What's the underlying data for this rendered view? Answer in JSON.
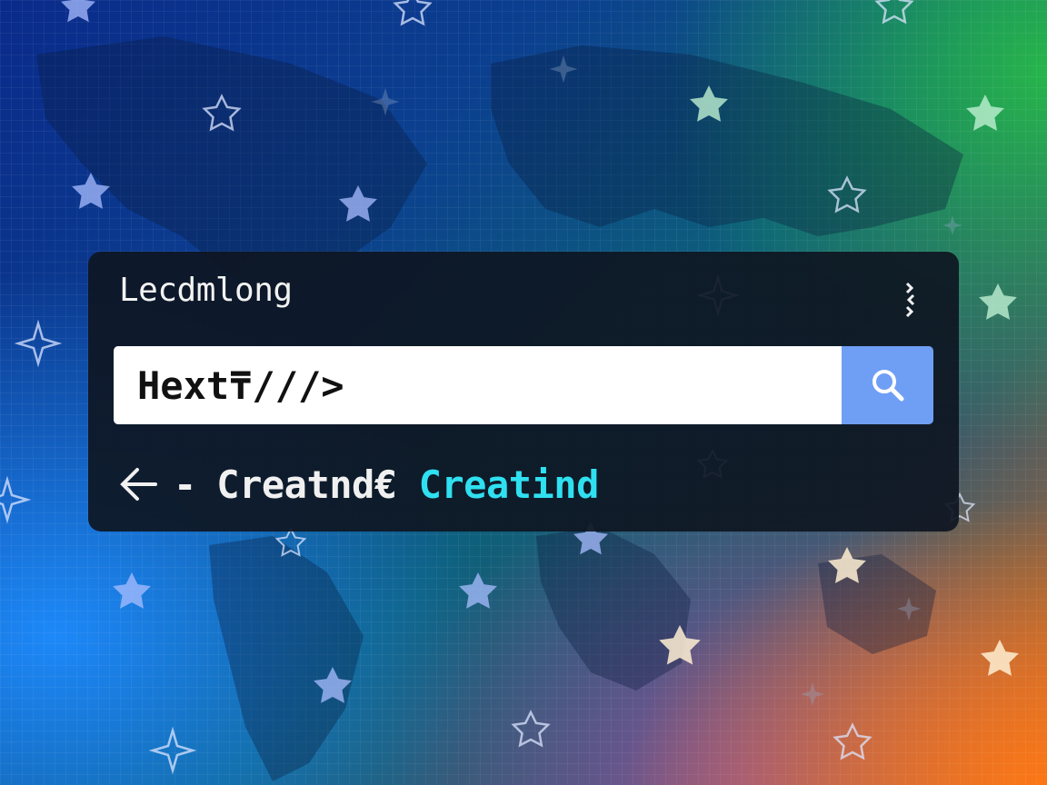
{
  "panel": {
    "title": "Lecdmlong"
  },
  "search": {
    "value": "Hext₸///>"
  },
  "breadcrumb": {
    "separator": "-",
    "item_1": "Creatnd€",
    "item_2": "Creatind"
  },
  "icons": {
    "menu": "more-vertical-icon",
    "search": "search-icon",
    "back": "arrow-left-icon"
  },
  "colors": {
    "panel_background": "#0e1622",
    "search_button": "#6f9ff5",
    "accent_text": "#2fe0f0"
  }
}
